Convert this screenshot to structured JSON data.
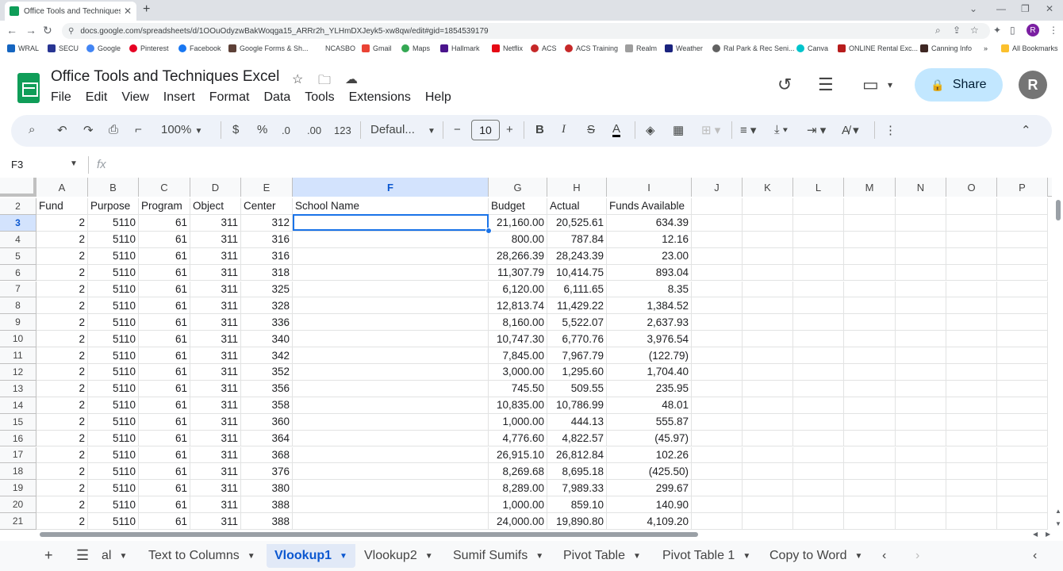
{
  "browser": {
    "tab_title": "Office Tools and Techniques Excel",
    "url": "docs.google.com/spreadsheets/d/1OOuOdyzwBakWoqga15_ARRr2h_YLHmDXJeyk5-xw8qw/edit#gid=1854539179",
    "profile_initial": "R",
    "bookmarks": [
      "WRAL",
      "SECU",
      "Google",
      "Pinterest",
      "Facebook",
      "Google Forms & Sh...",
      "NCASBO",
      "Gmail",
      "Maps",
      "Hallmark",
      "Netflix",
      "ACS",
      "ACS Training",
      "Realm",
      "Weather",
      "Ral Park & Rec Seni...",
      "Canva",
      "ONLINE Rental Exc...",
      "Canning Info",
      "All Bookmarks"
    ]
  },
  "sheets": {
    "doc_title": "Office Tools and Techniques Excel",
    "menu": [
      "File",
      "Edit",
      "View",
      "Insert",
      "Format",
      "Data",
      "Tools",
      "Extensions",
      "Help"
    ],
    "share_label": "Share",
    "avatar_initial": "R",
    "toolbar": {
      "zoom": "100%",
      "currency": "$",
      "percent": "%",
      "dec_decrease": ".0",
      "dec_increase": ".00",
      "number_format": "123",
      "font": "Defaul...",
      "font_size": "10"
    },
    "name_box": "F3",
    "fx": "fx"
  },
  "grid": {
    "columns": [
      "A",
      "B",
      "C",
      "D",
      "E",
      "F",
      "G",
      "H",
      "I",
      "J",
      "K",
      "L",
      "M",
      "N",
      "O",
      "P"
    ],
    "selected_column": "F",
    "headers": [
      "Fund",
      "Purpose",
      "Program",
      "Object",
      "Center",
      "School Name",
      "Budget",
      "Actual",
      "Funds Available"
    ],
    "row_numbers": [
      "2",
      "3",
      "4",
      "5",
      "6",
      "7",
      "8",
      "9",
      "10",
      "11",
      "12",
      "13",
      "14",
      "15",
      "16",
      "17",
      "18",
      "19",
      "20",
      "21"
    ],
    "selected_row": "3",
    "rows": [
      [
        "2",
        "5110",
        "61",
        "311",
        "312",
        "",
        "21,160.00",
        "20,525.61",
        "634.39"
      ],
      [
        "2",
        "5110",
        "61",
        "311",
        "316",
        "",
        "800.00",
        "787.84",
        "12.16"
      ],
      [
        "2",
        "5110",
        "61",
        "311",
        "316",
        "",
        "28,266.39",
        "28,243.39",
        "23.00"
      ],
      [
        "2",
        "5110",
        "61",
        "311",
        "318",
        "",
        "11,307.79",
        "10,414.75",
        "893.04"
      ],
      [
        "2",
        "5110",
        "61",
        "311",
        "325",
        "",
        "6,120.00",
        "6,111.65",
        "8.35"
      ],
      [
        "2",
        "5110",
        "61",
        "311",
        "328",
        "",
        "12,813.74",
        "11,429.22",
        "1,384.52"
      ],
      [
        "2",
        "5110",
        "61",
        "311",
        "336",
        "",
        "8,160.00",
        "5,522.07",
        "2,637.93"
      ],
      [
        "2",
        "5110",
        "61",
        "311",
        "340",
        "",
        "10,747.30",
        "6,770.76",
        "3,976.54"
      ],
      [
        "2",
        "5110",
        "61",
        "311",
        "342",
        "",
        "7,845.00",
        "7,967.79",
        "(122.79)"
      ],
      [
        "2",
        "5110",
        "61",
        "311",
        "352",
        "",
        "3,000.00",
        "1,295.60",
        "1,704.40"
      ],
      [
        "2",
        "5110",
        "61",
        "311",
        "356",
        "",
        "745.50",
        "509.55",
        "235.95"
      ],
      [
        "2",
        "5110",
        "61",
        "311",
        "358",
        "",
        "10,835.00",
        "10,786.99",
        "48.01"
      ],
      [
        "2",
        "5110",
        "61",
        "311",
        "360",
        "",
        "1,000.00",
        "444.13",
        "555.87"
      ],
      [
        "2",
        "5110",
        "61",
        "311",
        "364",
        "",
        "4,776.60",
        "4,822.57",
        "(45.97)"
      ],
      [
        "2",
        "5110",
        "61",
        "311",
        "368",
        "",
        "26,915.10",
        "26,812.84",
        "102.26"
      ],
      [
        "2",
        "5110",
        "61",
        "311",
        "376",
        "",
        "8,269.68",
        "8,695.18",
        "(425.50)"
      ],
      [
        "2",
        "5110",
        "61",
        "311",
        "380",
        "",
        "8,289.00",
        "7,989.33",
        "299.67"
      ],
      [
        "2",
        "5110",
        "61",
        "311",
        "388",
        "",
        "1,000.00",
        "859.10",
        "140.90"
      ],
      [
        "2",
        "5110",
        "61",
        "311",
        "388",
        "",
        "24,000.00",
        "19,890.80",
        "4,109.20"
      ]
    ]
  },
  "sheet_tabs": {
    "items": [
      "al",
      "Text to Columns",
      "Vlookup1",
      "Vlookup2",
      "Sumif Sumifs",
      "Pivot Table",
      "Pivot Table 1",
      "Copy to Word"
    ],
    "active": "Vlookup1"
  },
  "colors": {
    "accent": "#1a73e8",
    "sheets_green": "#0f9d58",
    "share_bg": "#c2e7ff",
    "toolbar_bg": "#eef2f9"
  }
}
